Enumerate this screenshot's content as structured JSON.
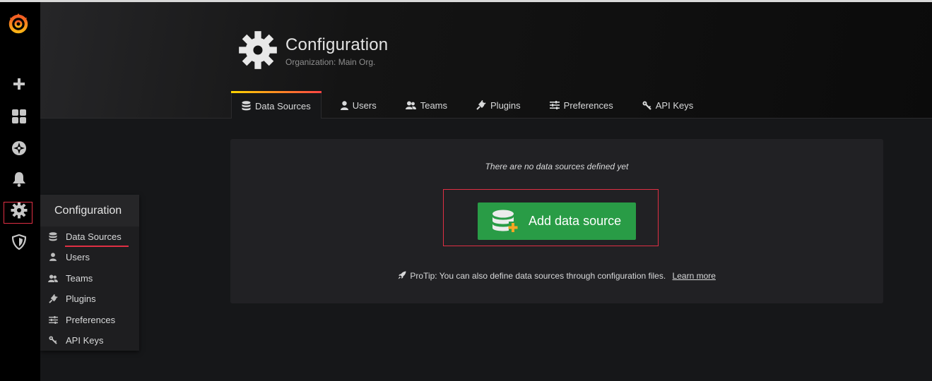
{
  "header": {
    "title": "Configuration",
    "subtitle": "Organization: Main Org."
  },
  "tabs": [
    {
      "label": "Data Sources",
      "icon": "database-icon",
      "active": true
    },
    {
      "label": "Users",
      "icon": "user-icon"
    },
    {
      "label": "Teams",
      "icon": "users-icon"
    },
    {
      "label": "Plugins",
      "icon": "plug-icon"
    },
    {
      "label": "Preferences",
      "icon": "sliders-icon"
    },
    {
      "label": "API Keys",
      "icon": "key-icon"
    }
  ],
  "sidenav": {
    "items": [
      "grafana-logo-icon",
      "plus-icon",
      "dashboards-icon",
      "explore-icon",
      "alerting-icon",
      "gear-icon",
      "shield-icon"
    ]
  },
  "submenu": {
    "title": "Configuration",
    "items": [
      {
        "label": "Data Sources",
        "active": true
      },
      {
        "label": "Users"
      },
      {
        "label": "Teams"
      },
      {
        "label": "Plugins"
      },
      {
        "label": "Preferences"
      },
      {
        "label": "API Keys"
      }
    ]
  },
  "panel": {
    "empty_message": "There are no data sources defined yet",
    "add_button_label": "Add data source",
    "protip": "ProTip: You can also define data sources through configuration files.",
    "learn_more": "Learn more"
  },
  "colors": {
    "accent_green": "#299c46",
    "highlight_red": "#e02f44",
    "tab_gradient_start": "#ffd500",
    "tab_gradient_end": "#ff4444"
  }
}
